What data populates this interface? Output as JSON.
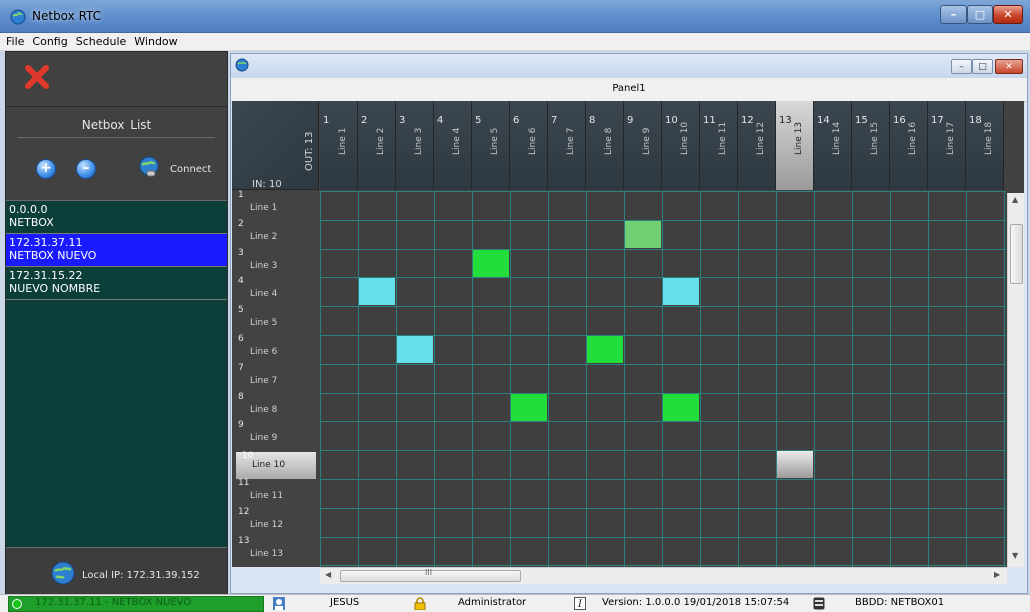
{
  "window": {
    "title": "Netbox RTC",
    "min": "–",
    "max": "□",
    "close": "✕"
  },
  "menu": [
    "File",
    "Config",
    "Schedule",
    "Window"
  ],
  "left": {
    "list_title": "Netbox  List",
    "connect_label": "Connect",
    "add_label": "+",
    "remove_label": "–",
    "items": [
      {
        "ip": "0.0.0.0",
        "name": "NETBOX",
        "selected": false
      },
      {
        "ip": "172.31.37.11",
        "name": "NETBOX NUEVO",
        "selected": true
      },
      {
        "ip": "172.31.15.22",
        "name": "NUEVO NOMBRE",
        "selected": false
      }
    ],
    "local_ip": "Local IP: 172.31.39.152"
  },
  "child": {
    "panel_title": "Panel1"
  },
  "matrix": {
    "out_label": "OUT: 13",
    "in_label": "IN: 10",
    "columns": [
      {
        "num": "1",
        "name": "Line 1"
      },
      {
        "num": "2",
        "name": "Line 2"
      },
      {
        "num": "3",
        "name": "Line 3"
      },
      {
        "num": "4",
        "name": "Line 4"
      },
      {
        "num": "5",
        "name": "Line 5"
      },
      {
        "num": "6",
        "name": "Line 6"
      },
      {
        "num": "7",
        "name": "Line 7"
      },
      {
        "num": "8",
        "name": "Line 8"
      },
      {
        "num": "9",
        "name": "Line 9"
      },
      {
        "num": "10",
        "name": "Line 10"
      },
      {
        "num": "11",
        "name": "Line 11"
      },
      {
        "num": "12",
        "name": "Line 12"
      },
      {
        "num": "13",
        "name": "Line 13"
      },
      {
        "num": "14",
        "name": "Line 14"
      },
      {
        "num": "15",
        "name": "Line 15"
      },
      {
        "num": "16",
        "name": "Line 16"
      },
      {
        "num": "17",
        "name": "Line 17"
      },
      {
        "num": "18",
        "name": "Line 18"
      }
    ],
    "rows": [
      {
        "num": "1",
        "name": "Line 1"
      },
      {
        "num": "2",
        "name": "Line 2"
      },
      {
        "num": "3",
        "name": "Line 3"
      },
      {
        "num": "4",
        "name": "Line 4"
      },
      {
        "num": "5",
        "name": "Line 5"
      },
      {
        "num": "6",
        "name": "Line 6"
      },
      {
        "num": "7",
        "name": "Line 7"
      },
      {
        "num": "8",
        "name": "Line 8"
      },
      {
        "num": "9",
        "name": "Line 9"
      },
      {
        "num": "10",
        "name": "Line 10"
      },
      {
        "num": "11",
        "name": "Line 11"
      },
      {
        "num": "12",
        "name": "Line 12"
      },
      {
        "num": "13",
        "name": "Line 13"
      }
    ],
    "selected_out": 13,
    "selected_in": 10,
    "crosspoints": [
      {
        "row": 2,
        "col": 9,
        "color": "#6fcf73"
      },
      {
        "row": 3,
        "col": 5,
        "color": "#22dd3a"
      },
      {
        "row": 4,
        "col": 2,
        "color": "#66e0ea"
      },
      {
        "row": 4,
        "col": 10,
        "color": "#66e0ea"
      },
      {
        "row": 6,
        "col": 3,
        "color": "#66e0ea"
      },
      {
        "row": 6,
        "col": 8,
        "color": "#22dd3a"
      },
      {
        "row": 8,
        "col": 6,
        "color": "#22dd3a"
      },
      {
        "row": 8,
        "col": 10,
        "color": "#22dd3a"
      },
      {
        "row": 10,
        "col": 13,
        "color": "#bdbdbd"
      }
    ],
    "hscroll_grip": "III"
  },
  "status": {
    "connection": "172.31.37.11 - NETBOX NUEVO",
    "user": "JESUS",
    "role": "Administrator",
    "version": "Version: 1.0.0.0  19/01/2018 15:07:54",
    "db": "BBDD: NETBOX01"
  },
  "colors": {
    "grid_line": "#2c8080",
    "list_bg": "#0c3e3a",
    "selected_item": "#1a1aff",
    "status_green": "#1e9e2a"
  }
}
